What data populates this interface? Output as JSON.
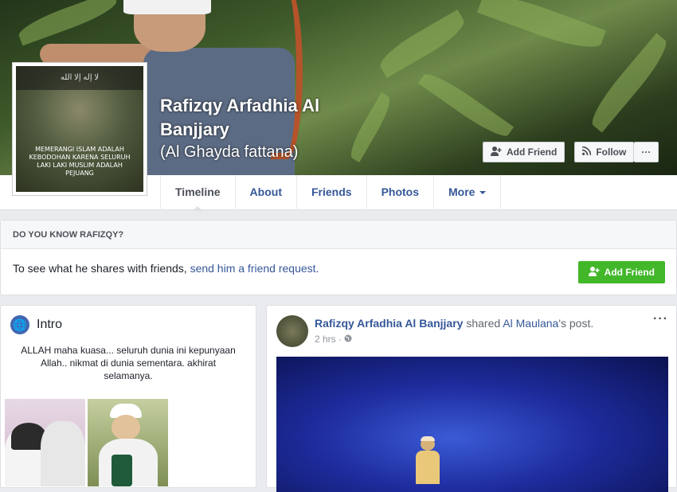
{
  "profile": {
    "name": "Rafizqy Arfadhia Al Banjjary",
    "alternate_name": "(Al Ghayda fattana)",
    "picture_text": "MEMERANGI ISLAM ADALAH KEBODOHAN KARENA SELURUH LAKI LAKI MUSLIM ADALAH PEJUANG"
  },
  "cover_actions": {
    "add_friend": "Add Friend",
    "follow": "Follow",
    "more": "···"
  },
  "tabs": [
    {
      "label": "Timeline"
    },
    {
      "label": "About"
    },
    {
      "label": "Friends"
    },
    {
      "label": "Photos"
    },
    {
      "label": "More"
    }
  ],
  "know_box": {
    "heading": "DO YOU KNOW RAFIZQY?",
    "text_prefix": "To see what he shares with friends, ",
    "link_text": "send him a friend request.",
    "button": "Add Friend"
  },
  "intro": {
    "title": "Intro",
    "bio": "ALLAH maha kuasa... seluruh dunia ini kepunyaan Allah.. nikmat di dunia sementara. akhirat selamanya."
  },
  "post": {
    "author": "Rafizqy Arfadhia Al Banjjary",
    "shared_text": "shared",
    "shared_from": "Al Maulana",
    "shared_suffix": "'s post.",
    "time": "2 hrs",
    "menu": "···"
  },
  "icons": {
    "add_friend": "add-friend-icon",
    "follow": "rss-icon",
    "intro": "globe-icon",
    "privacy": "public-globe-icon"
  },
  "colors": {
    "link": "#365899",
    "green": "#42b72a",
    "background": "#e9ebee"
  }
}
